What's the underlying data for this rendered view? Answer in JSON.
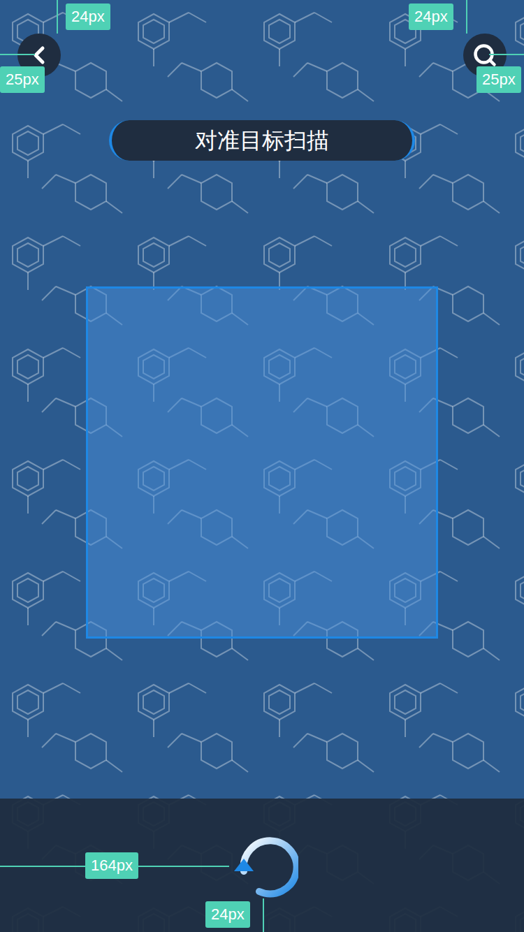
{
  "title": "对准目标扫描",
  "annotations": [
    {
      "text": "24px"
    },
    {
      "text": "25px"
    },
    {
      "text": "24px"
    },
    {
      "text": "25px"
    },
    {
      "text": "164px"
    },
    {
      "text": "24px"
    }
  ]
}
